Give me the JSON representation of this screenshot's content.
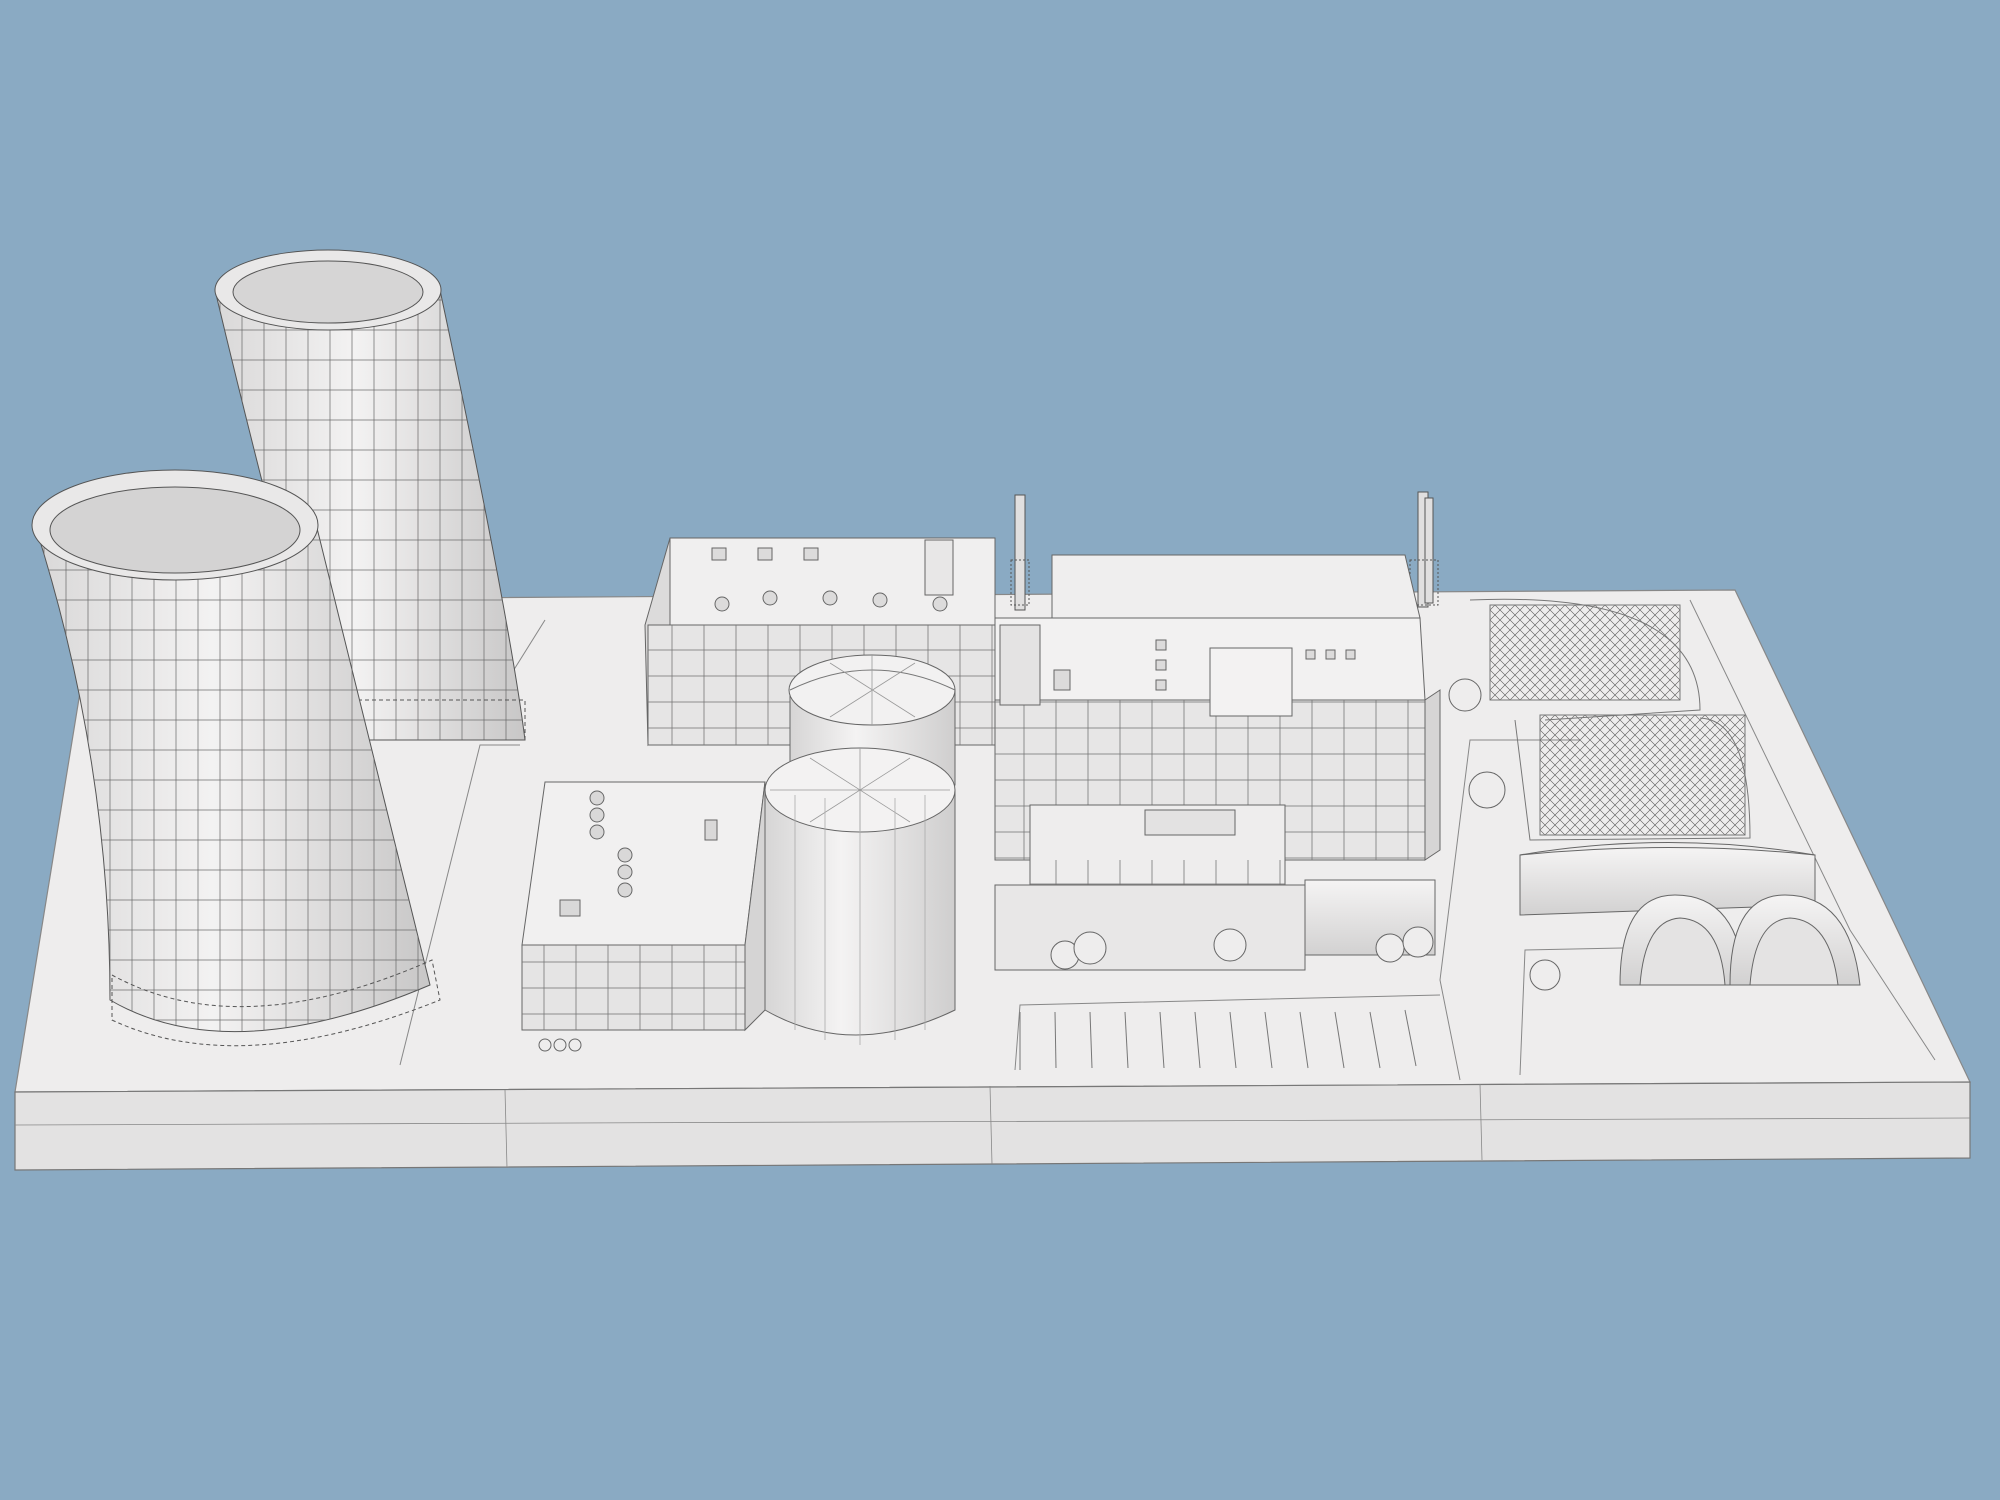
{
  "colors": {
    "background": "#8aaac3",
    "model_face_light": "#f1f0ef",
    "model_face_mid": "#e2e1e0",
    "model_face_dark": "#c9c8c8",
    "wire": "#555555",
    "shadow": "#cfcfcf"
  },
  "objects": [
    "cooling-tower",
    "cooling-tower",
    "reactor-containment-dome",
    "reactor-containment-dome",
    "turbine-hall",
    "auxiliary-building",
    "office-building",
    "switchyard",
    "quonset-hangar",
    "quonset-hangar",
    "quonset-hangar",
    "exhaust-stack",
    "exhaust-stack",
    "tree",
    "parking-lot"
  ]
}
